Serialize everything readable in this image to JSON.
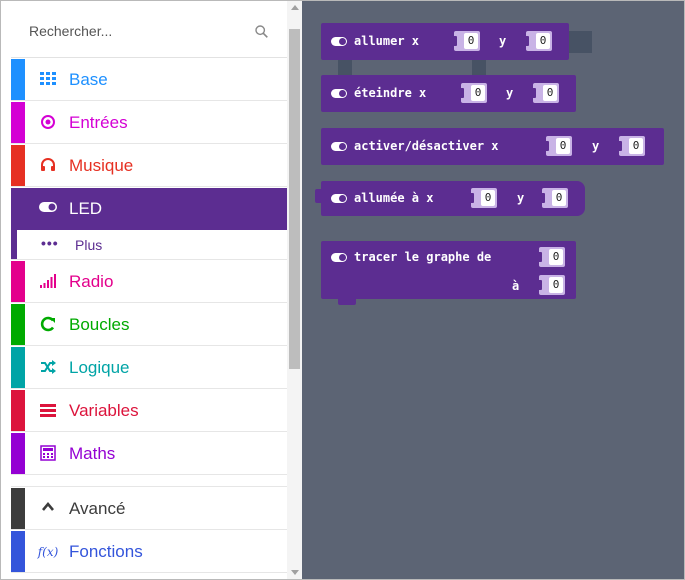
{
  "search": {
    "placeholder": "Rechercher..."
  },
  "categories": [
    {
      "label": "Base",
      "color": "#1e90ff",
      "icon": "grid-icon"
    },
    {
      "label": "Entrées",
      "color": "#d400d4",
      "icon": "target-icon"
    },
    {
      "label": "Musique",
      "color": "#e63022",
      "icon": "headphones-icon"
    },
    {
      "label": "LED",
      "color": "#5c2d91",
      "icon": "toggle-icon",
      "selected": true
    },
    {
      "label": "Plus",
      "color": "#5c2d91",
      "icon": "more-dots-icon",
      "sub": true
    },
    {
      "label": "Radio",
      "color": "#e3008c",
      "icon": "signal-bars-icon"
    },
    {
      "label": "Boucles",
      "color": "#00aa00",
      "icon": "loop-icon"
    },
    {
      "label": "Logique",
      "color": "#00a4a6",
      "icon": "shuffle-icon"
    },
    {
      "label": "Variables",
      "color": "#dc143c",
      "icon": "list-icon"
    },
    {
      "label": "Maths",
      "color": "#9400d3",
      "icon": "calculator-icon"
    },
    {
      "label": "Avancé",
      "color": "#3c3c3c",
      "icon": "chevron-up-icon"
    },
    {
      "label": "Fonctions",
      "color": "#3455db",
      "icon": "function-icon"
    }
  ],
  "blocks": [
    {
      "label": "allumer x",
      "y_label": "y",
      "x_value": "0",
      "y_value": "0"
    },
    {
      "label": "éteindre x",
      "y_label": "y",
      "x_value": "0",
      "y_value": "0"
    },
    {
      "label": "activer/désactiver x",
      "y_label": "y",
      "x_value": "0",
      "y_value": "0"
    },
    {
      "label": "allumée à x",
      "y_label": "y",
      "x_value": "0",
      "y_value": "0"
    }
  ],
  "plot_block": {
    "label": "tracer le graphe de",
    "second_label": "à",
    "value": "0",
    "max_value": "0"
  },
  "colors": {
    "flyout_bg": "#5c6474",
    "led_block": "#5c2d91"
  }
}
